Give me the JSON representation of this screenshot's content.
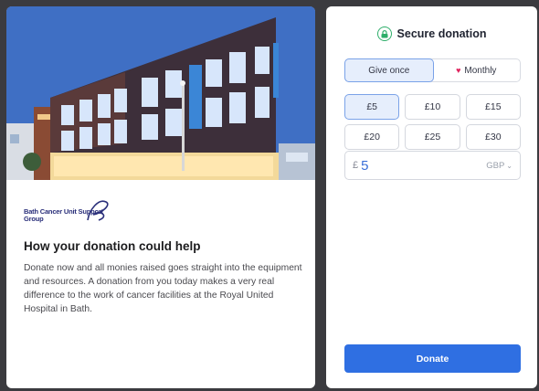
{
  "campaign": {
    "image_alt": "Building exterior at dusk",
    "org_logo_text": "Bath Cancer Unit Support Group",
    "title": "How your donation could help",
    "description": "Donate now and all monies raised goes straight into the equipment and resources. A donation from you today makes a very real difference to the work of cancer facilities at the Royal United Hospital in Bath."
  },
  "donation_form": {
    "secure_label": "Secure donation",
    "secure_icon": "lock-icon",
    "frequency": {
      "options": [
        {
          "label": "Give once",
          "selected": true
        },
        {
          "label": "Monthly",
          "icon": "heart-icon",
          "selected": false
        }
      ]
    },
    "amounts": [
      {
        "label": "£5",
        "selected": true
      },
      {
        "label": "£10",
        "selected": false
      },
      {
        "label": "£15",
        "selected": false
      },
      {
        "label": "£20",
        "selected": false
      },
      {
        "label": "£25",
        "selected": false
      },
      {
        "label": "£30",
        "selected": false
      }
    ],
    "custom_amount": {
      "currency_symbol": "£",
      "value": "5",
      "currency": "GBP"
    },
    "submit_label": "Donate",
    "colors": {
      "primary": "#2f6fe2",
      "selected_bg": "#e6eefc",
      "secure": "#2eae6a",
      "heart": "#e0245e"
    }
  }
}
